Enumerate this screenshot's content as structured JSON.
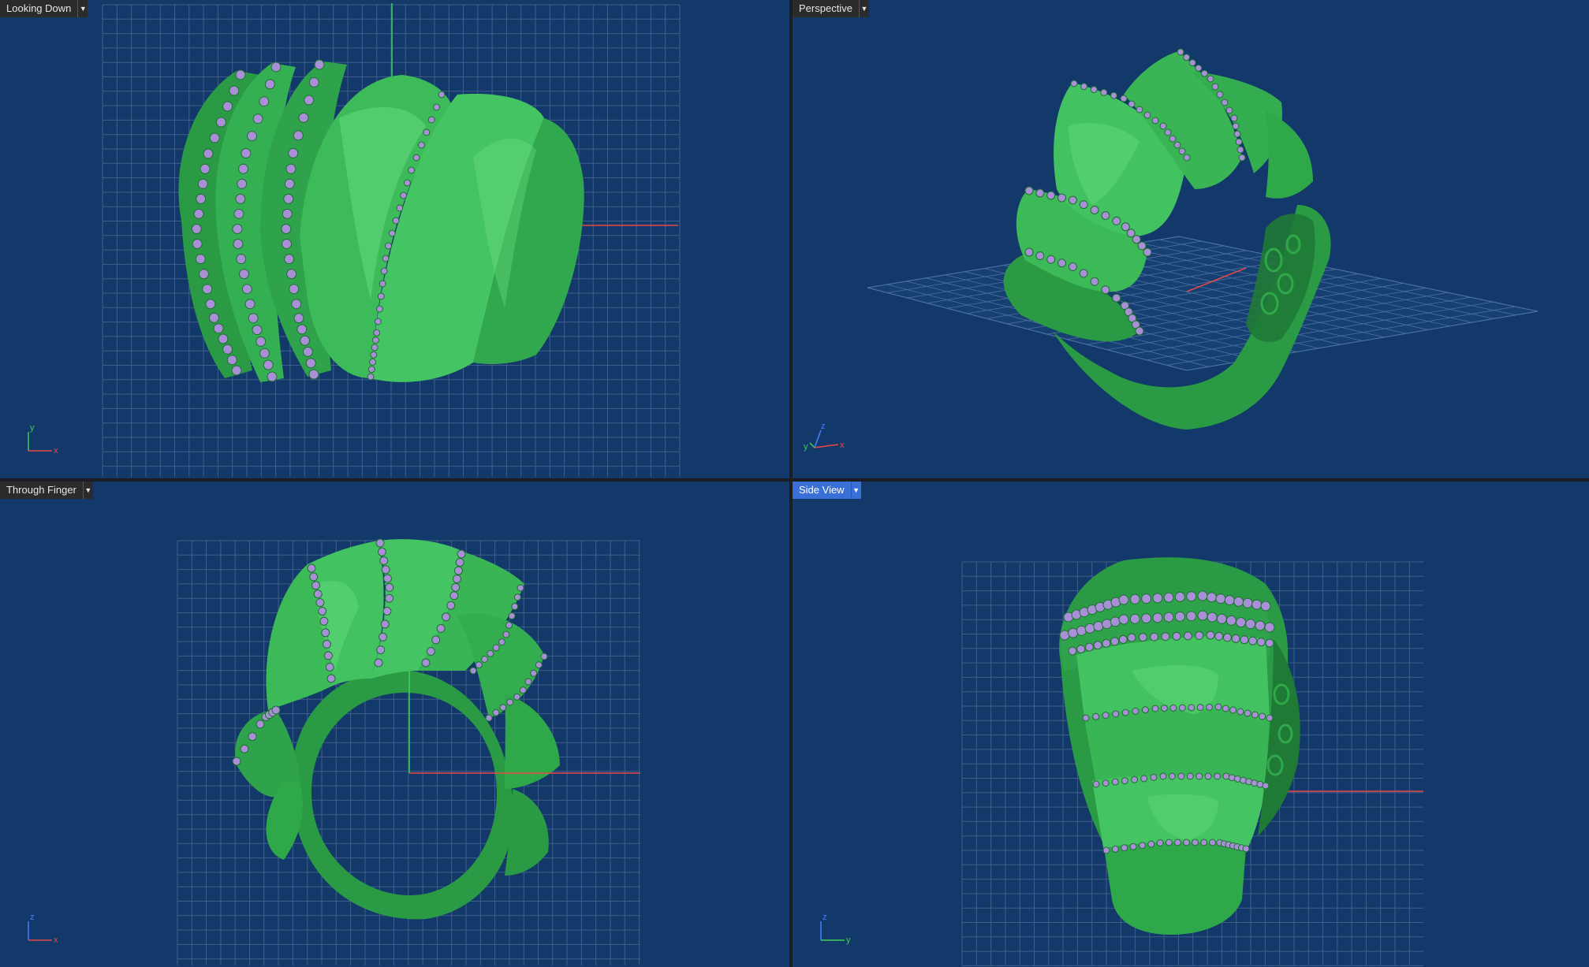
{
  "viewports": {
    "top_left": {
      "title": "Looking Down",
      "active": false,
      "axes": [
        "y",
        "x"
      ]
    },
    "top_right": {
      "title": "Perspective",
      "active": false,
      "axes": [
        "z",
        "y",
        "x"
      ]
    },
    "bottom_left": {
      "title": "Through Finger",
      "active": false,
      "axes": [
        "z",
        "x"
      ]
    },
    "bottom_right": {
      "title": "Side View",
      "active": true,
      "axes": [
        "z",
        "y"
      ]
    }
  },
  "colors": {
    "viewport_bg": "#13396a",
    "grid": "#3f5f88",
    "model": "#2fa84a",
    "model_dark": "#1d6f2f",
    "model_light": "#6fe285",
    "gem": "#a98fd6",
    "axis_x": "#e84848",
    "axis_y": "#3fcf5a",
    "axis_z": "#4a7cff",
    "active_tab": "#3b6fd8"
  },
  "model": {
    "name": "ring",
    "icon": "ring-model-icon"
  }
}
